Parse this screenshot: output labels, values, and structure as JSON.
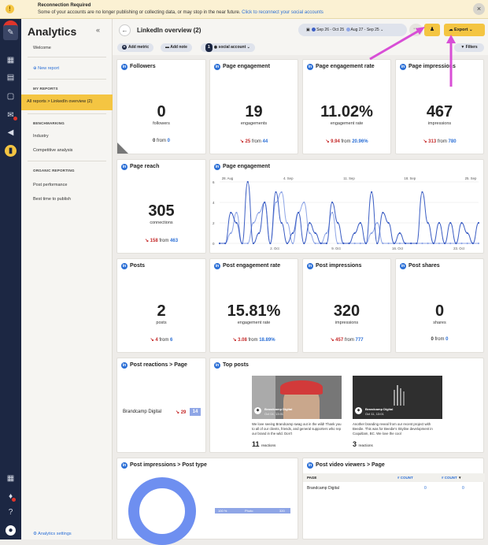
{
  "banner": {
    "title": "Reconnection Required",
    "message": "Some of your accounts are no longer publishing or collecting data, or may stop in the near future.",
    "link": "Click to reconnect your social accounts"
  },
  "sidebar": {
    "title": "Analytics",
    "welcome": "Welcome",
    "new_report": "New report",
    "my_reports_heading": "MY REPORTS",
    "active_report": "All reports > LinkedIn overview (2)",
    "benchmarking_heading": "BENCHMARKING",
    "benchmarking_items": [
      "Industry",
      "Competitive analysis"
    ],
    "organic_heading": "ORGANIC REPORTING",
    "organic_items": [
      "Post performance",
      "Best time to publish"
    ],
    "settings": "Analytics settings"
  },
  "header": {
    "title": "LinkedIn overview (2)",
    "date_range_1": "Sep 26 - Oct 25",
    "date_range_2": "Aug 27 - Sep 25",
    "export_label": "Export",
    "add_metric": "Add metric",
    "add_note": "Add note",
    "social_count": "1",
    "social_account": "social account",
    "filters": "Filters"
  },
  "colors": {
    "accent": "#f4c542",
    "primary_series": "#3d5fc4",
    "secondary_series": "#8fa6e6",
    "negative": "#c52a2a",
    "annotation_arrow": "#d84ed6"
  },
  "metrics": {
    "followers": {
      "title": "Followers",
      "value": "0",
      "label": "followers",
      "delta": "0",
      "from": "0"
    },
    "page_engagement": {
      "title": "Page engagement",
      "value": "19",
      "label": "engagements",
      "delta": "25",
      "from": "44"
    },
    "page_engagement_rate": {
      "title": "Page engagement rate",
      "value": "11.02%",
      "label": "engagement rate",
      "delta": "9.94",
      "from": "20.96%"
    },
    "page_impressions": {
      "title": "Page impressions",
      "value": "467",
      "label": "impressions",
      "delta": "313",
      "from": "780"
    },
    "page_reach": {
      "title": "Page reach",
      "value": "305",
      "label": "connections",
      "delta": "158",
      "from": "463"
    },
    "posts": {
      "title": "Posts",
      "value": "2",
      "label": "posts",
      "delta": "4",
      "from": "6"
    },
    "post_engagement_rate": {
      "title": "Post engagement rate",
      "value": "15.81%",
      "label": "engagement rate",
      "delta": "3.08",
      "from": "18.89%"
    },
    "post_impressions": {
      "title": "Post impressions",
      "value": "320",
      "label": "impressions",
      "delta": "457",
      "from": "777"
    },
    "post_shares": {
      "title": "Post shares",
      "value": "0",
      "label": "shares",
      "delta": "0",
      "from": "0"
    }
  },
  "from_word": "from",
  "engagement_chart_title": "Page engagement",
  "chart_data": {
    "type": "line",
    "top_x_labels": [
      "28. Aug",
      "4. Sep",
      "11. Sep",
      "18. Sep",
      "25. Sep"
    ],
    "bottom_x_labels": [
      "2. Oct",
      "9. Oct",
      "16. Oct",
      "23. Oct"
    ],
    "ylim": [
      0,
      6
    ],
    "yticks": [
      0,
      2,
      4,
      6
    ],
    "series": [
      {
        "values": [
          0,
          0,
          3,
          2,
          0,
          6,
          0,
          1,
          4,
          0,
          5,
          2,
          0,
          1,
          3,
          0,
          2,
          1,
          0,
          0,
          4,
          2,
          0,
          0,
          1,
          2,
          0,
          5,
          0,
          3,
          2,
          0,
          1,
          0,
          0,
          0,
          5,
          2,
          0,
          2,
          0,
          2,
          0,
          2,
          1,
          0,
          2
        ]
      },
      {
        "values": [
          0,
          0,
          1,
          3,
          0,
          0,
          2,
          3,
          4,
          0,
          4,
          5,
          2,
          0,
          3,
          4,
          1,
          0,
          0,
          1,
          3,
          0,
          0,
          0,
          0,
          0,
          0,
          1,
          2,
          0,
          0,
          0,
          0,
          0,
          0,
          0,
          0,
          0,
          0,
          0,
          0,
          0,
          0,
          0,
          0,
          0,
          0
        ]
      }
    ]
  },
  "reactions": {
    "title": "Post reactions > Page",
    "page": "Brandcamp Digital",
    "delta": "29",
    "value": "14"
  },
  "top_posts": {
    "title": "Top posts",
    "items": [
      {
        "author": "Brandcamp Digital",
        "date": "Oct 04, 13:01",
        "text": "We love seeing Brandcamp swag out in the wild! Thank you to all of our clients, friends, and general supporters who rep our brand in the wild. Don't",
        "count": "11",
        "count_label": "reactions"
      },
      {
        "author": "Brandcamp Digital",
        "date": "Oct 11, 13:01",
        "text": "Another branding reveal from our recent project with Beedie. This was for Beedie's Skyline development in Coquitlam, BC. We love the cool",
        "count": "3",
        "count_label": "reactions"
      }
    ]
  },
  "impr_type": {
    "title": "Post impressions > Post type",
    "pct": "100 %",
    "type": "Photo",
    "value": "320"
  },
  "video_viewers": {
    "title": "Post video viewers > Page",
    "col_page": "PAGE",
    "col_count1": "COUNT",
    "col_count2": "COUNT",
    "page": "Brandcamp Digital",
    "count1": "0",
    "count2": "0"
  }
}
